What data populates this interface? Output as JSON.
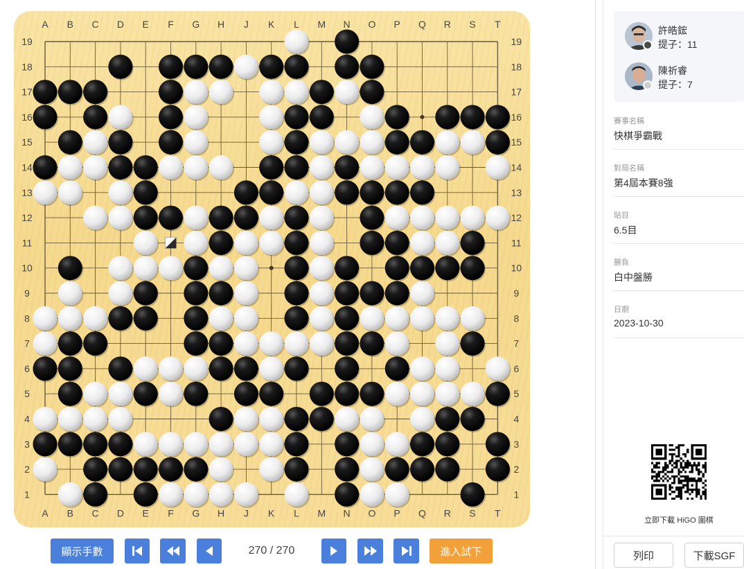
{
  "board": {
    "size": 19,
    "columns": [
      "A",
      "B",
      "C",
      "D",
      "E",
      "F",
      "G",
      "H",
      "J",
      "K",
      "L",
      "M",
      "N",
      "O",
      "P",
      "Q",
      "R",
      "S",
      "T"
    ],
    "rows_top_to_bottom": [
      "..........W.B......",
      "...B.BBBWBB.BB.....",
      "BBB..BWW.WWBWB.....",
      "B.BW.BW..WBB.WB.BBB",
      ".BWB.BW..WBWWWBBWWB",
      "BWWBBWWW.BBWBWWWW.W",
      "WW.WB...BBWWBBBB...",
      "..WWBBWBBWBW.BWWWWW",
      "....WLWBWWBW.BBWWB.",
      ".B.WWWBWW.BWB.BBBB.",
      ".W.WB.BBW.BWBBBW...",
      "WWWBB.BWW.BWBWWWWW.",
      "WBB...BBWWWWBBW.WB.",
      "BB.BWWWBBWB.B.BWW.W",
      ".BWWBWB.BB.BBBWWWWB",
      "WWWW...BWWBBWW.WBB.",
      "BBBBWWWWWWB.BWWBB.B",
      "W.BBBBBW.WB.BWBBB.B",
      ".WB.BWWWW.W.BWW..B."
    ],
    "hoshi": [
      "D16",
      "K16",
      "Q16",
      "D10",
      "K10",
      "Q10",
      "D4",
      "K4",
      "Q4"
    ],
    "last_move": "F11",
    "colors": {
      "black": "#111111",
      "white": "#f4f4f4",
      "grid": "#6b5a3a"
    }
  },
  "controls": {
    "show_moves_label": "顯示手數",
    "first_icon": "first-move-icon",
    "prev_many_icon": "rewind-icon",
    "prev_icon": "previous-move-icon",
    "move_counter": "270 / 270",
    "next_icon": "next-move-icon",
    "next_many_icon": "fast-forward-icon",
    "last_icon": "last-move-icon",
    "try_label": "進入試下",
    "accent_blue": "#4a7fdc",
    "accent_orange": "#f2a13a"
  },
  "players": [
    {
      "name": "許皓鋐",
      "captures": "提子：11",
      "color": "black"
    },
    {
      "name": "陳祈睿",
      "captures": "提子：7",
      "color": "white"
    }
  ],
  "info": [
    {
      "label": "賽事名稱",
      "value": "快棋爭霸戰"
    },
    {
      "label": "對局名稱",
      "value": "第4屆本賽8強"
    },
    {
      "label": "貼目",
      "value": "6.5目"
    },
    {
      "label": "勝負",
      "value": "白中盤勝"
    },
    {
      "label": "日期",
      "value": "2023-10-30"
    }
  ],
  "qr_caption": "立即下載 HiGO 圍棋",
  "buttons": {
    "print": "列印",
    "download": "下載SGF"
  }
}
